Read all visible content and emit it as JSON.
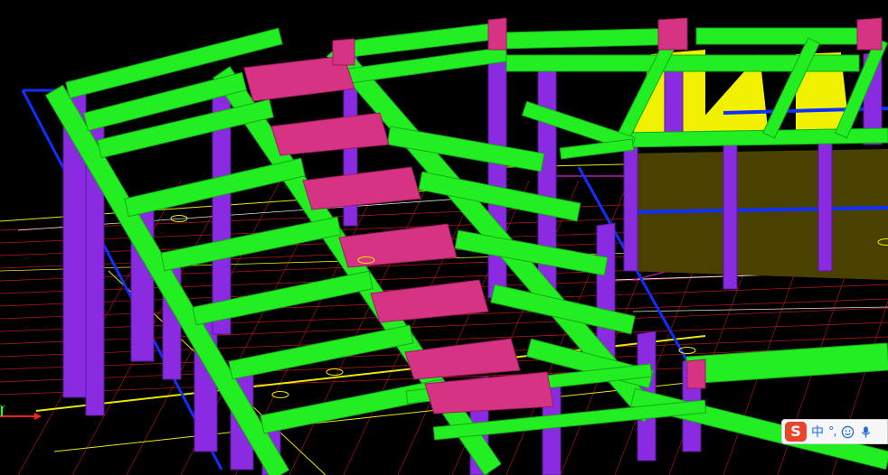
{
  "viewport": {
    "background": "#000000",
    "colors": {
      "beam": "#22ee22",
      "beam_edge": "#15a815",
      "column": "#8a2be2",
      "column_edge": "#5a1a9a",
      "stair": "#d63384",
      "slab": "#f0f000",
      "slab_dark": "#4a4000",
      "axis_blue": "#1030ff",
      "grid_red": "#c01818",
      "grid_yellow": "#e8e800",
      "grid_white": "#e0e0e0",
      "magenta_line": "#e020e0",
      "ucs_x": "#ff2020",
      "ucs_y": "#20ff20"
    }
  },
  "ucs": {
    "y_label": "Y"
  },
  "ime_toolbar": {
    "logo": "S",
    "mode": "中",
    "punct": "°,",
    "icons": [
      "smiley-icon",
      "microphone-icon"
    ],
    "accent": "#e8452c"
  }
}
